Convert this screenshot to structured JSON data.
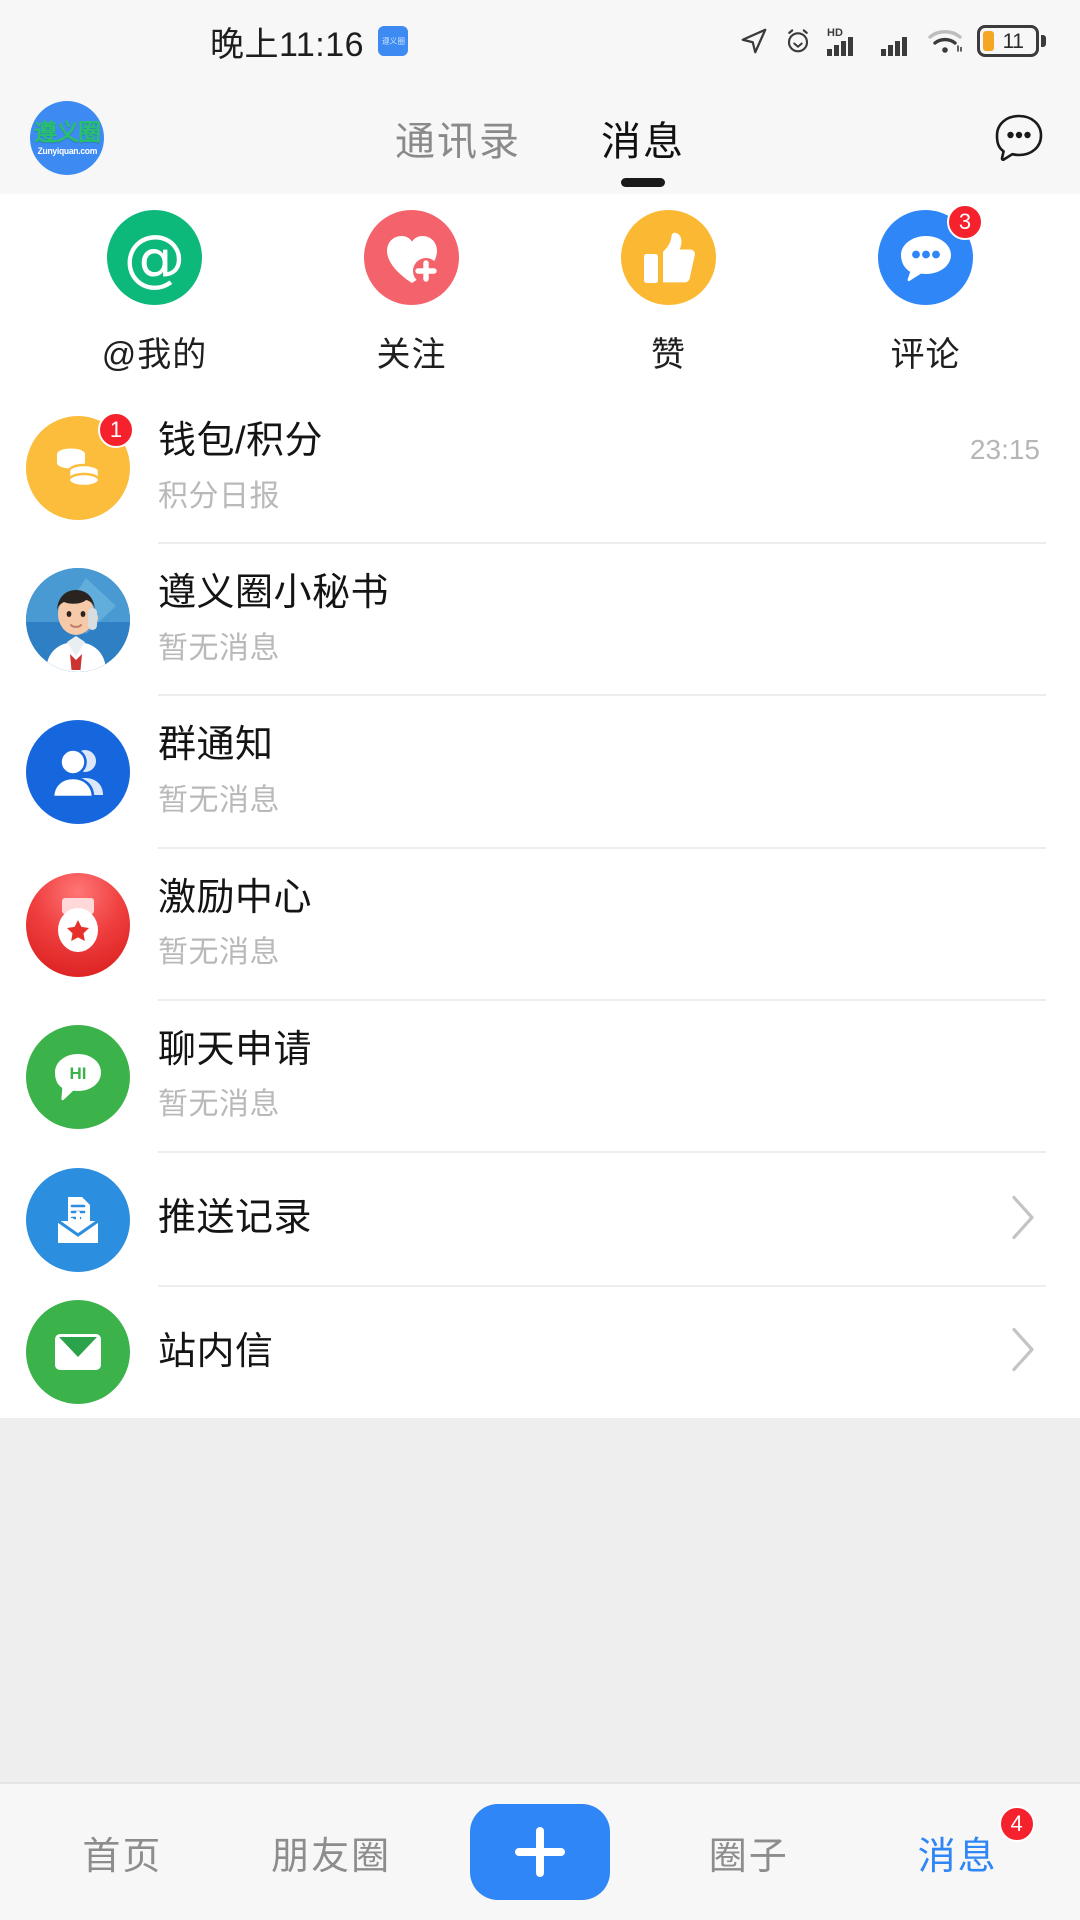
{
  "status_bar": {
    "time": "晚上11:16",
    "app_icon_name": "zunyiquan-app-icon",
    "battery_percent": "11",
    "icons": [
      "location-arrow-icon",
      "alarm-clock-icon",
      "hd-icon",
      "signal-icon-1",
      "signal-icon-2",
      "wifi-icon",
      "battery-icon"
    ]
  },
  "header": {
    "logo_text_cn": "遵义圈",
    "logo_text_en": "Zunyiquan.com",
    "tabs": [
      {
        "label": "通讯录",
        "active": false
      },
      {
        "label": "消息",
        "active": true
      }
    ],
    "more_label": "…"
  },
  "quick_actions": [
    {
      "label": "@我的",
      "glyph": "@",
      "color": "#0cb97a",
      "badge": ""
    },
    {
      "label": "关注",
      "glyph": "heart-plus-icon",
      "color": "#f4636b",
      "badge": ""
    },
    {
      "label": "赞",
      "glyph": "thumbs-up-icon",
      "color": "#fbb832",
      "badge": ""
    },
    {
      "label": "评论",
      "glyph": "comment-dots-icon",
      "color": "#2f86f6",
      "badge": "3"
    }
  ],
  "messages": [
    {
      "title": "钱包/积分",
      "subtitle": "积分日报",
      "time": "23:15",
      "badge": "1",
      "avatar": "wallet-coins-icon",
      "chevron": false
    },
    {
      "title": "遵义圈小秘书",
      "subtitle": "暂无消息",
      "time": "",
      "badge": "",
      "avatar": "customer-service-avatar",
      "chevron": false
    },
    {
      "title": "群通知",
      "subtitle": "暂无消息",
      "time": "",
      "badge": "",
      "avatar": "group-user-icon",
      "chevron": false
    },
    {
      "title": "激励中心",
      "subtitle": "暂无消息",
      "time": "",
      "badge": "",
      "avatar": "red-packet-star-icon",
      "chevron": false
    },
    {
      "title": "聊天申请",
      "subtitle": "暂无消息",
      "time": "",
      "badge": "",
      "avatar": "hi-bubble-icon",
      "chevron": false
    },
    {
      "title": "推送记录",
      "subtitle": "",
      "time": "",
      "badge": "",
      "avatar": "inbox-document-icon",
      "chevron": true
    },
    {
      "title": "站内信",
      "subtitle": "",
      "time": "",
      "badge": "",
      "avatar": "envelope-icon",
      "chevron": true
    }
  ],
  "bottom_nav": {
    "items": [
      {
        "label": "首页",
        "active": false,
        "badge": ""
      },
      {
        "label": "朋友圈",
        "active": false,
        "badge": ""
      },
      {
        "label": "+",
        "active": false,
        "badge": "",
        "is_plus": true
      },
      {
        "label": "圈子",
        "active": false,
        "badge": ""
      },
      {
        "label": "消息",
        "active": true,
        "badge": "4"
      }
    ]
  },
  "colors": {
    "accent": "#2f86f6",
    "badge": "#f5222d",
    "page_bg": "#eeeeee",
    "card_bg": "#ffffff"
  }
}
